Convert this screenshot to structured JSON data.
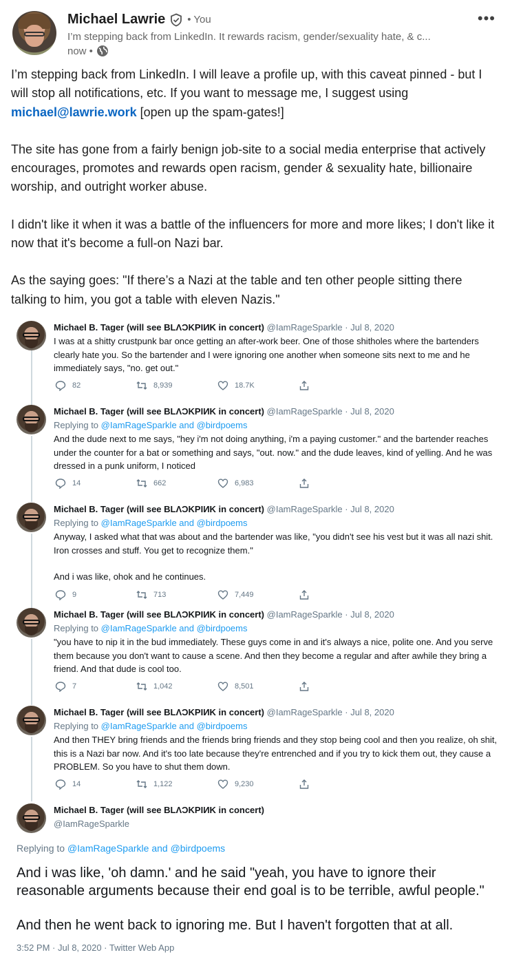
{
  "post": {
    "author": "Michael Lawrie",
    "you_label": "• You",
    "headline": "I’m stepping back from LinkedIn. It rewards racism, gender/sexuality hate, & c...",
    "time": "now •",
    "paragraphs": {
      "p1_before": "I’m stepping back from LinkedIn. I will leave a profile up, with this caveat pinned - but I will stop all notifications, etc. If you want to message me, I suggest using ",
      "p1_email": "michael@lawrie.work",
      "p1_after": " [open up the spam-gates!]",
      "p2": "The site has gone from a fairly benign job-site to a social media enterprise that actively encourages, promotes and rewards open racism, gender & sexuality hate, billionaire worship, and outright worker abuse.",
      "p3": "I didn't like it when it was a battle of the influencers for more and more likes; I don't like it now that it's become a full-on Nazi bar.",
      "p4": "As the saying goes: \"If there’s a Nazi at the table and ten other people sitting there talking to him, you got a table with eleven Nazis.\""
    }
  },
  "tweets": [
    {
      "name": "Michael B. Tager (will see BLΛƆKPIИK in concert)",
      "meta": "@IamRageSparkle · Jul 8, 2020",
      "reply_prefix": "",
      "reply_mentions": "",
      "text": [
        "I was at a shitty crustpunk bar once getting an after-work beer. One of those shitholes where the bartenders clearly hate you. So the bartender and I were ignoring one another when someone sits next to me and he immediately says, \"no. get out.\""
      ],
      "replies": "82",
      "retweets": "8,939",
      "likes": "18.7K"
    },
    {
      "name": "Michael B. Tager (will see BLΛƆKPIИK in concert)",
      "meta": "@IamRageSparkle · Jul 8, 2020",
      "reply_prefix": "Replying to ",
      "reply_mentions": "@IamRageSparkle and @birdpoems",
      "text": [
        "And the dude next to me says, \"hey i'm not doing anything, i'm a paying customer.\" and the bartender reaches under the counter for a bat or something and says, \"out. now.\" and the dude leaves, kind of yelling. And he was dressed in a punk uniform, I noticed"
      ],
      "replies": "14",
      "retweets": "662",
      "likes": "6,983"
    },
    {
      "name": "Michael B. Tager (will see BLΛƆKPIИK in concert)",
      "meta": "@IamRageSparkle · Jul 8, 2020",
      "reply_prefix": "Replying to ",
      "reply_mentions": "@IamRageSparkle and @birdpoems",
      "text": [
        "Anyway, I asked what that was about and the bartender was like, \"you didn't see his vest but it was all nazi shit. Iron crosses and stuff. You get to recognize them.\"",
        "And i was like, ohok and he continues."
      ],
      "replies": "9",
      "retweets": "713",
      "likes": "7,449"
    },
    {
      "name": "Michael B. Tager (will see BLΛƆKPIИK in concert)",
      "meta": "@IamRageSparkle · Jul 8, 2020",
      "reply_prefix": "Replying to ",
      "reply_mentions": "@IamRageSparkle and @birdpoems",
      "text": [
        "\"you have to nip it in the bud immediately. These guys come in and it's always a nice, polite one. And you serve them because you don't want to cause a scene. And then they become a regular and after awhile they bring a friend. And that dude is cool too."
      ],
      "replies": "7",
      "retweets": "1,042",
      "likes": "8,501"
    },
    {
      "name": "Michael B. Tager (will see BLΛƆKPIИK in concert)",
      "meta": "@IamRageSparkle · Jul 8, 2020",
      "reply_prefix": "Replying to ",
      "reply_mentions": "@IamRageSparkle and @birdpoems",
      "text": [
        "And then THEY bring friends and the friends bring friends and they stop being cool and then you realize, oh shit, this is a Nazi bar now. And it's too late because they're entrenched and if you try to kick them out, they cause a PROBLEM. So you have to shut them down."
      ],
      "replies": "14",
      "retweets": "1,122",
      "likes": "9,230"
    }
  ],
  "last_tweet": {
    "name": "Michael B. Tager (will see BLΛƆKPIИK in concert)",
    "handle": "@IamRageSparkle",
    "reply_prefix": "Replying to ",
    "reply_mentions": "@IamRageSparkle and @birdpoems",
    "text1": "And i was like, 'oh damn.' and he said \"yeah, you have to ignore their reasonable arguments because their end goal is to be terrible, awful people.\"",
    "text2": "And then he went back to ignoring me. But I haven't forgotten that at all.",
    "footer": "3:52 PM · Jul 8, 2020 · Twitter Web App"
  },
  "colors": {
    "link": "#0a66c2",
    "twitter_blue": "#1d9bf0",
    "muted": "#657786"
  }
}
